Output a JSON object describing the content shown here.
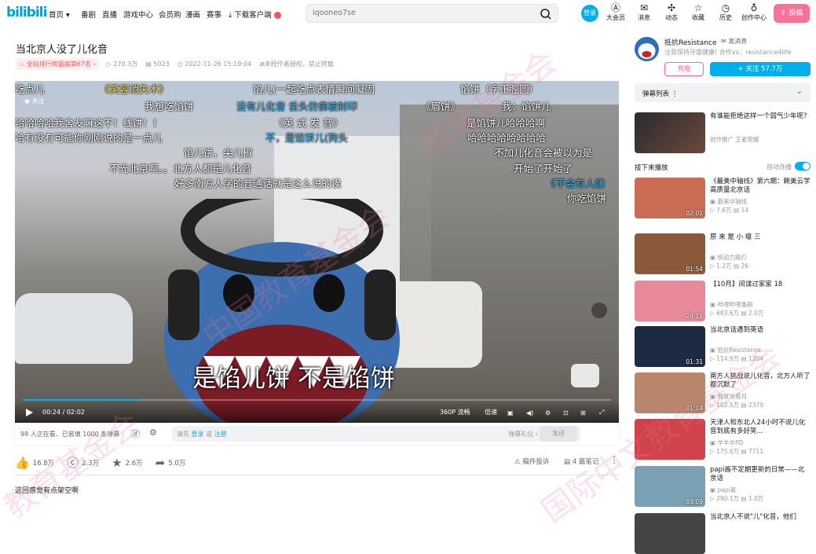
{
  "topbar": {
    "logo": "bilibili",
    "nav": [
      "首页 ▾",
      "番剧",
      "直播",
      "游戏中心",
      "会员购",
      "漫画",
      "赛事",
      "下载客户端"
    ],
    "search_placeholder": "iqooneo7se",
    "login": "登录",
    "icons": [
      {
        "label": "大会员",
        "icon": "vip-icon"
      },
      {
        "label": "消息",
        "icon": "message-icon"
      },
      {
        "label": "动态",
        "icon": "dynamic-icon"
      },
      {
        "label": "收藏",
        "icon": "star-icon"
      },
      {
        "label": "历史",
        "icon": "clock-icon"
      },
      {
        "label": "创作中心",
        "icon": "bulb-icon"
      }
    ],
    "upload": "投稿"
  },
  "video": {
    "title": "当北京人没了儿化音",
    "rank": "全站排行榜最高第67名 ›",
    "views": "270.3万",
    "danmaku": "5023",
    "date": "2022-11-26 15:19:04",
    "copyright": "未经作者授权，禁止转载"
  },
  "player": {
    "uploader_tag": "关注",
    "subtitle": "是馅儿饼 不是馅饼",
    "time": "00:24 / 02:02",
    "progress": 0.197,
    "quality": "360P 流畅",
    "speed": "倍速",
    "danmaku_lines": [
      {
        "text": "吃点儿",
        "c": "w"
      },
      {
        "text": "《笑容消失术》",
        "c": "y"
      },
      {
        "text": "馅儿(一起吃点表情瞬间凝固",
        "c": "w"
      },
      {
        "text": "馅饼（字正腔圆）",
        "c": "w"
      },
      {
        "text": "我想吃馅饼",
        "c": "w"
      },
      {
        "text": "没有儿化音  舌头仿佛被封印",
        "c": "b"
      },
      {
        "text": "《眉饼》",
        "c": "w"
      },
      {
        "text": "我：馅饼儿",
        "c": "w"
      },
      {
        "text": "哈哈哈哈我舍友嘛这不！线饼！！",
        "c": "w"
      },
      {
        "text": "《英 式 发 音》",
        "c": "w"
      },
      {
        "text": "是馅饼儿哈哈哈啊",
        "c": "w"
      },
      {
        "text": "哈有没有可能你刚刚说的是一点儿",
        "c": "w"
      },
      {
        "text": "不，是馅饼儿(狗头",
        "c": "b"
      },
      {
        "text": "哈哈哈哈哈哈哈哈",
        "c": "w"
      },
      {
        "text": "馅儿饼，尖儿椒",
        "c": "w"
      },
      {
        "text": "不加儿化音会被以为是",
        "c": "w"
      },
      {
        "text": "不光北京啊。。北方人都是儿化音",
        "c": "w"
      },
      {
        "text": "开始了开始了",
        "c": "w"
      },
      {
        "text": "好多南方人学的普通话就是这么说的诶",
        "c": "w"
      },
      {
        "text": "《不会有人嫌",
        "c": "b"
      },
      {
        "text": "你吃馅饼",
        "c": "w"
      }
    ]
  },
  "sendbar": {
    "watching": "98 人正在看，已装填 1000 条弹幕",
    "placeholder_pre": "请先",
    "login": "登录",
    "or": "或",
    "register": "注册",
    "etiquette": "弹幕礼仪 ›",
    "send": "发送"
  },
  "actions": {
    "like": "16.8万",
    "coin": "2.3万",
    "fav": "2.6万",
    "share": "5.0万",
    "report": "稿件投诉",
    "notes": "4 篇笔记"
  },
  "description": "这回感觉有点架空啊",
  "uploader": {
    "name": "抵抗Resistance",
    "msg": "发消息",
    "sign": "注意保持牙龈健康! 合作vx：resistance4life",
    "charge": "充电",
    "follow": "+ 关注 57.7万"
  },
  "dmlist_label": "弹幕列表  ⋮",
  "ad": {
    "title": "有谁能拒绝这样一个弱气少年呢?",
    "tag": "创作推广  王者荣耀"
  },
  "next_label": "接下来播放",
  "autoplay": "自动连播",
  "recs": [
    {
      "title": "《最美中轴线》第六期：赖美云学高质量北京话",
      "up": "最美中轴线",
      "views": "7.6万",
      "dm": "14",
      "dur": "02:01",
      "color": "#c96b55"
    },
    {
      "title": "原 来 是 小 瘪 三",
      "up": "核动力路灯",
      "views": "1.2万",
      "dm": "26",
      "dur": "01:54",
      "color": "#8a5a3a"
    },
    {
      "title": "【10月】间谍过家家 18",
      "up": "哔哩哔哩番剧",
      "views": "683.6万",
      "dm": "2.0万",
      "dur": "24:11",
      "color": "#e88a9a"
    },
    {
      "title": "当北京话遇到英语",
      "up": "抵抗Resistance",
      "views": "114.9万",
      "dm": "1204",
      "dur": "01:31",
      "color": "#1d2a44"
    },
    {
      "title": "南方人挑战说儿化音，北方人听了都沉默了",
      "up": "我就是曼月",
      "views": "102.5万",
      "dm": "2379",
      "dur": "01:14",
      "color": "#b8866a"
    },
    {
      "title": "天津人和东北人24小时不说儿化音到底有多好笑...",
      "up": "羊羊羊PD",
      "views": "175.6万",
      "dm": "7711",
      "dur": "",
      "color": "#d0434a"
    },
    {
      "title": "papi酱不定期更新的日常——北京话",
      "up": "papi酱",
      "views": "290.1万",
      "dm": "1.0万",
      "dur": "03:09",
      "color": "#7aa0b4"
    },
    {
      "title": "当北京人不说\"儿\"化音，他们",
      "up": "",
      "views": "",
      "dm": "",
      "dur": "",
      "color": "#444"
    }
  ],
  "watermark": [
    "中国教育基金会",
    "教育基金会",
    "国际中文教育基金会"
  ]
}
